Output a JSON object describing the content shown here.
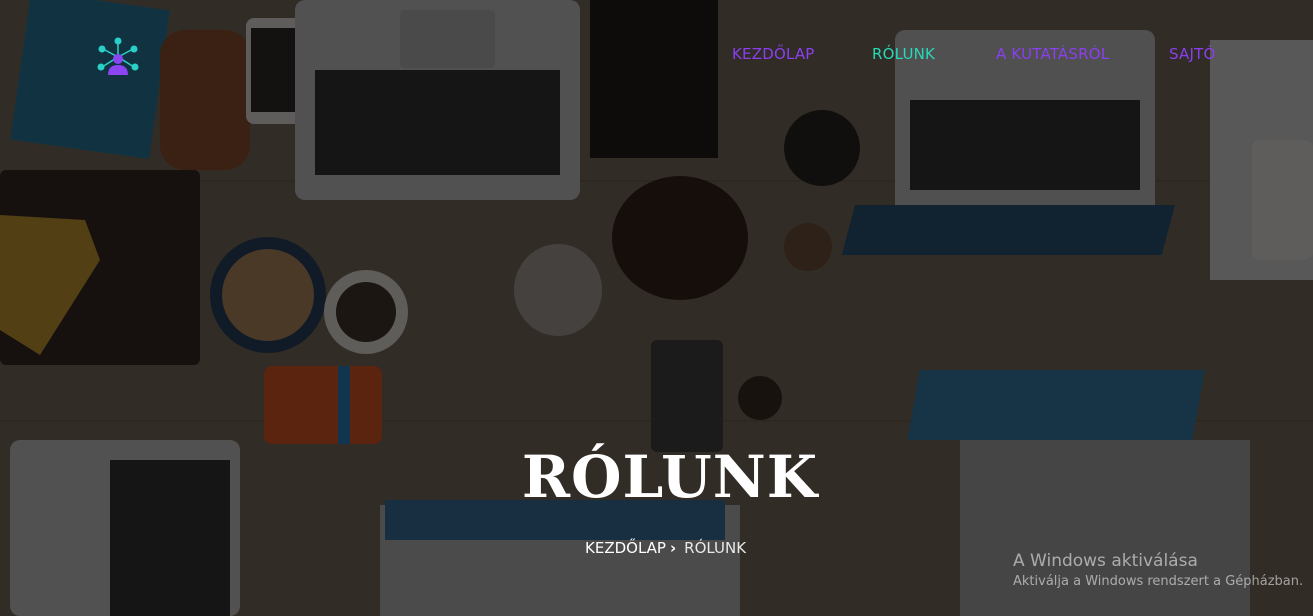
{
  "colors": {
    "nav_purple": "#8a3ff0",
    "nav_teal": "#26d9b8",
    "logo_teal": "#2ad0c8",
    "logo_purple": "#8b45f2",
    "title_white": "#ffffff"
  },
  "logo": {
    "icon": "team-network-icon"
  },
  "nav": {
    "items": [
      {
        "label": "KEZDŐLAP",
        "active": false
      },
      {
        "label": "RÓLUNK",
        "active": true
      },
      {
        "label": "A KUTATÁSRÓL",
        "active": false
      },
      {
        "label": "SAJTÓ",
        "active": false
      }
    ]
  },
  "page": {
    "title": "RÓLUNK",
    "breadcrumb": {
      "home": "KEZDŐLAP",
      "separator_icon": "chevron-right-icon",
      "current": "RÓLUNK"
    }
  },
  "watermark": {
    "line1": "A Windows aktiválása",
    "line2": "Aktiválja a Windows rendszert a Gépházban."
  }
}
